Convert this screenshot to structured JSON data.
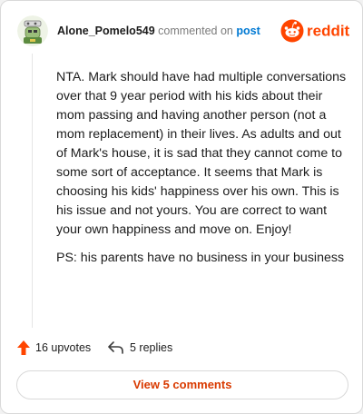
{
  "comment": {
    "username": "Alone_Pomelo549",
    "action_text": "commented on",
    "post_link": "post",
    "paragraphs": [
      "NTA. Mark should have had multiple conversations over that 9 year period with his kids about their mom passing and having another person (not a mom replacement) in their lives. As adults and out of Mark's house, it is sad that they cannot come to some sort of acceptance. It seems that Mark is choosing his kids' happiness over his own. This is his issue and not yours. You are correct to want your own happiness and move on. Enjoy!",
      "PS: his parents have no business in your business"
    ]
  },
  "brand": {
    "name": "reddit",
    "color": "#ff4500"
  },
  "actions": {
    "upvotes": "16 upvotes",
    "replies": "5 replies"
  },
  "footer": {
    "view_comments": "View 5 comments"
  },
  "colors": {
    "accent_orange": "#d93a00",
    "link_blue": "#0079d3",
    "upvote": "#ff4500"
  },
  "icons": {
    "avatar": "avatar-image",
    "brand": "reddit-logo-icon",
    "upvote": "upvote-arrow-icon",
    "reply": "reply-arrow-icon"
  }
}
